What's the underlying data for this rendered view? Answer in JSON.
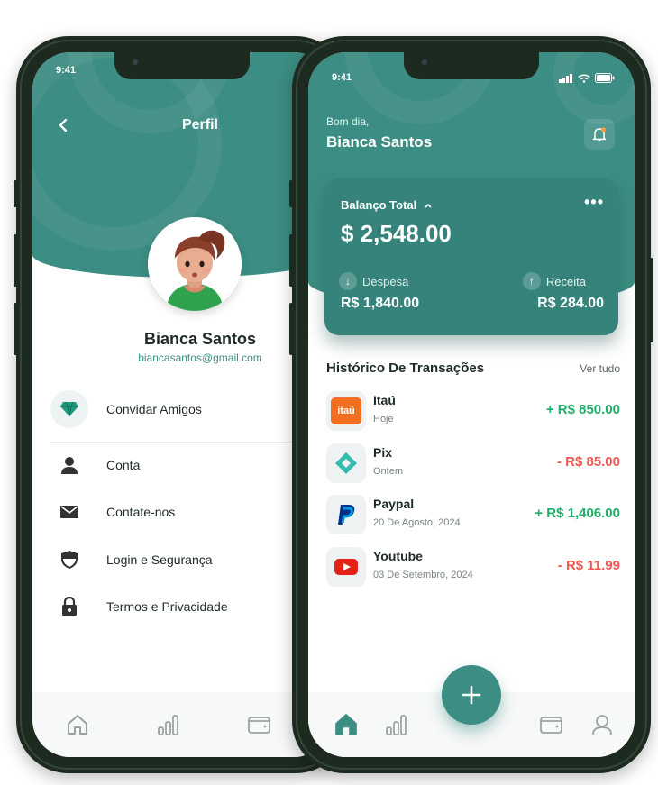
{
  "colors": {
    "brand_teal": "#3c8d83",
    "positive": "#1fae6a",
    "negative": "#ef5a57",
    "text_dark": "#1f2a2a"
  },
  "left_screen": {
    "status_time": "9:41",
    "title": "Perfil",
    "user_name": "Bianca Santos",
    "user_email": "biancasantos@gmail.com",
    "menu": [
      {
        "label": "Convidar Amigos",
        "icon": "diamond-icon"
      },
      {
        "label": "Conta",
        "icon": "user-icon"
      },
      {
        "label": "Contate-nos",
        "icon": "mail-icon"
      },
      {
        "label": "Login  e Segurança",
        "icon": "shield-icon"
      },
      {
        "label": "Termos e Privacidade",
        "icon": "lock-icon"
      }
    ],
    "tabs": [
      "home-icon",
      "chart-icon",
      "wallet-icon"
    ]
  },
  "right_screen": {
    "status_time": "9:41",
    "greeting": "Bom dia,",
    "user_name": "Bianca Santos",
    "balance": {
      "title": "Balanço Total",
      "amount": "$ 2,548.00",
      "expense_label": "Despesa",
      "expense_value": "R$ 1,840.00",
      "income_label": "Receita",
      "income_value": "R$ 284.00"
    },
    "history": {
      "title": "Histórico De Transações",
      "see_all": "Ver tudo",
      "items": [
        {
          "name": "Itaú",
          "date": "Hoje",
          "amount": "+ R$ 850.00",
          "type": "positive",
          "icon": "itau-logo"
        },
        {
          "name": "Pix",
          "date": "Ontem",
          "amount": "- R$ 85.00",
          "type": "negative",
          "icon": "pix-logo"
        },
        {
          "name": "Paypal",
          "date": "20 De Agosto, 2024",
          "amount": "+ R$ 1,406.00",
          "type": "positive",
          "icon": "paypal-logo"
        },
        {
          "name": "Youtube",
          "date": "03 De Setembro, 2024",
          "amount": "- R$ 11.99",
          "type": "negative",
          "icon": "youtube-logo"
        }
      ]
    },
    "itau_logo_text": "itaú",
    "tabs": [
      "home-icon",
      "chart-icon",
      "wallet-icon",
      "profile-icon"
    ]
  }
}
